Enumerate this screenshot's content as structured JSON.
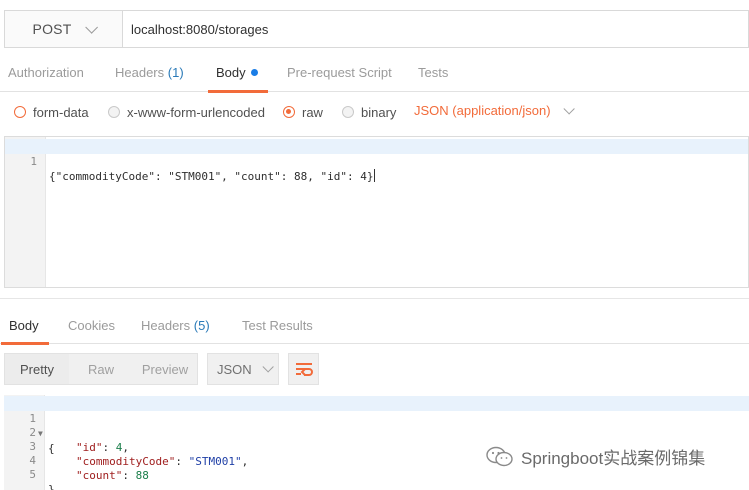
{
  "request": {
    "method": "POST",
    "url": "localhost:8080/storages"
  },
  "request_tabs": [
    {
      "label": "Authorization"
    },
    {
      "label": "Headers",
      "count": "(1)"
    },
    {
      "label": "Body"
    },
    {
      "label": "Pre-request Script"
    },
    {
      "label": "Tests"
    }
  ],
  "body_types": [
    {
      "label": "form-data",
      "selected": false
    },
    {
      "label": "x-www-form-urlencoded",
      "selected": false
    },
    {
      "label": "raw",
      "selected": true
    },
    {
      "label": "binary",
      "selected": false
    }
  ],
  "content_type": "JSON (application/json)",
  "request_body": {
    "line_numbers": [
      "1"
    ],
    "lines": [
      "{\"commodityCode\": \"STM001\", \"count\": 88, \"id\": 4}"
    ]
  },
  "response_tabs": [
    {
      "label": "Body"
    },
    {
      "label": "Cookies"
    },
    {
      "label": "Headers",
      "count": "(5)"
    },
    {
      "label": "Test Results"
    }
  ],
  "view_modes": [
    "Pretty",
    "Raw",
    "Preview"
  ],
  "format": "JSON",
  "response_body": {
    "line_numbers": [
      "1",
      "2",
      "3",
      "4",
      "5"
    ],
    "open_brace": "{",
    "close_brace": "}",
    "fields": [
      {
        "key": "\"id\"",
        "value": "4",
        "trail": ","
      },
      {
        "key": "\"commodityCode\"",
        "value": "\"STM001\"",
        "trail": ","
      },
      {
        "key": "\"count\"",
        "value": "88",
        "trail": ""
      }
    ]
  },
  "watermark": "Springboot实战案例锦集",
  "colors": {
    "accent": "#f26b3a",
    "count_blue": "#2a7ab8",
    "dirty_dot": "#1a7de6"
  },
  "icons": {
    "method_dropdown": "chevron-down-icon",
    "content_type_dropdown": "chevron-down-icon",
    "format_dropdown": "chevron-down-icon",
    "wrap": "wrap-lines-icon",
    "watermark": "wechat-icon"
  }
}
